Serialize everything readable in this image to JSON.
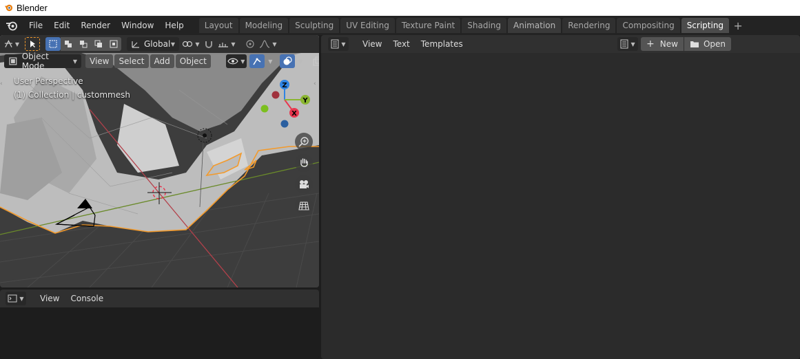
{
  "window": {
    "title": "Blender"
  },
  "menu": {
    "file": "File",
    "edit": "Edit",
    "render": "Render",
    "window": "Window",
    "help": "Help"
  },
  "workspaces": {
    "tabs": [
      "Layout",
      "Modeling",
      "Sculpting",
      "UV Editing",
      "Texture Paint",
      "Shading",
      "Animation",
      "Rendering",
      "Compositing",
      "Scripting"
    ],
    "active": "Scripting",
    "add_icon": "+"
  },
  "viewport": {
    "toolbar": {
      "transform_orientation": "Global"
    },
    "header": {
      "mode": "Object Mode",
      "view": "View",
      "select": "Select",
      "add": "Add",
      "object": "Object"
    },
    "overlay": {
      "perspective": "User Perspective",
      "collection": "(1) Collection | custommesh"
    },
    "gizmo": {
      "z": "Z",
      "y": "Y",
      "x": "X"
    }
  },
  "console": {
    "header": {
      "view": "View",
      "console": "Console"
    }
  },
  "text_editor": {
    "header": {
      "view": "View",
      "text": "Text",
      "templates": "Templates",
      "new": "New",
      "open": "Open"
    }
  },
  "colors": {
    "accent_blue": "#4772b3",
    "selection_orange": "#f39a2b",
    "axis_x": "#e8374f",
    "axis_y": "#8ab531",
    "axis_z": "#2f84e3"
  }
}
